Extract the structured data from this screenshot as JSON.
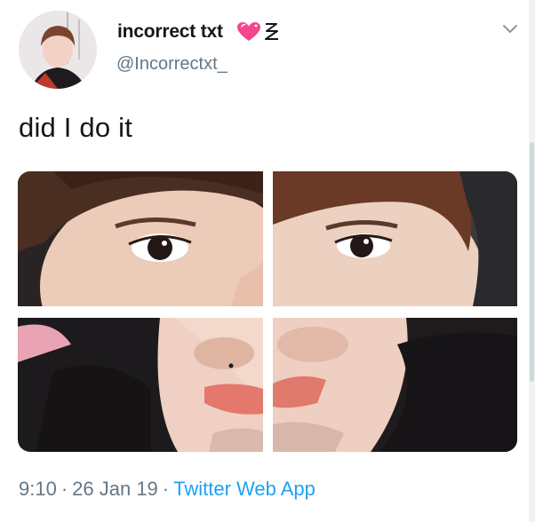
{
  "user": {
    "display_name": "incorrect txt",
    "handle": "@Incorrectxt_",
    "avatar_icon": "avatar-photo",
    "emoji": [
      "sparkling-heart-icon",
      "squiggle-icon"
    ]
  },
  "tweet": {
    "text": "did I do it",
    "time": "9:10",
    "date": "26 Jan 19",
    "separator": "·",
    "source": "Twitter Web App"
  },
  "media": {
    "layout": "2x2-photo-grid",
    "tiles": [
      "top-left",
      "top-right",
      "bottom-left",
      "bottom-right"
    ]
  },
  "colors": {
    "text": "#14171a",
    "secondary": "#657786",
    "link": "#1da1f2",
    "heart": "#f4478f"
  }
}
